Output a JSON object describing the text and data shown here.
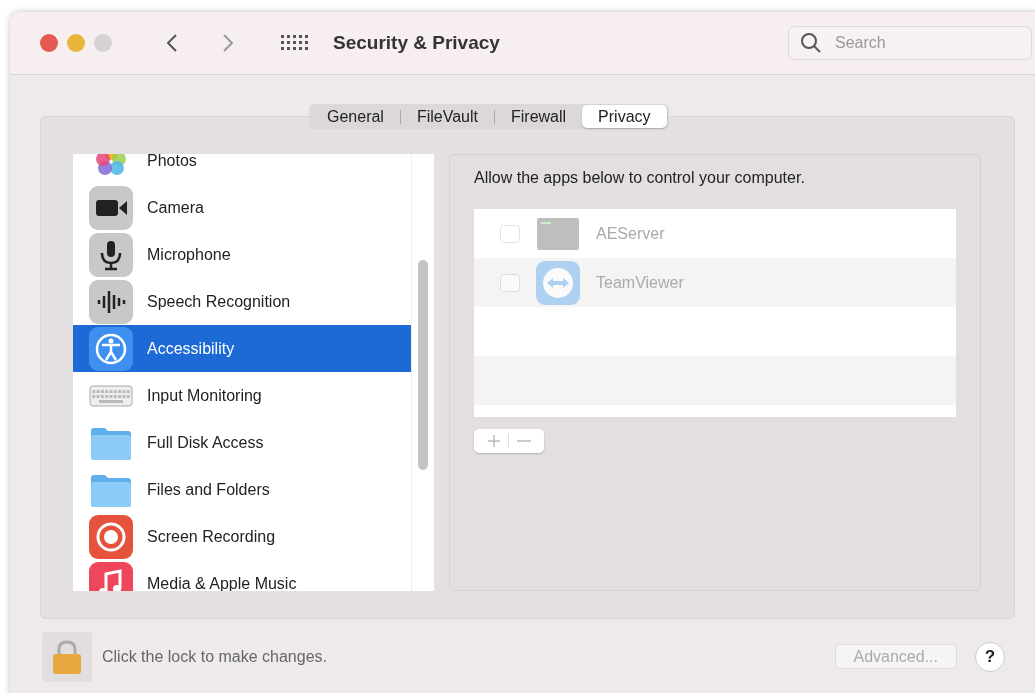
{
  "window": {
    "title": "Security & Privacy"
  },
  "search": {
    "placeholder": "Search"
  },
  "tabs": [
    {
      "label": "General",
      "selected": false
    },
    {
      "label": "FileVault",
      "selected": false
    },
    {
      "label": "Firewall",
      "selected": false
    },
    {
      "label": "Privacy",
      "selected": true
    }
  ],
  "sidebar": {
    "items": [
      {
        "label": "Photos",
        "kind": "photos",
        "selected": false
      },
      {
        "label": "Camera",
        "kind": "camera",
        "selected": false
      },
      {
        "label": "Microphone",
        "kind": "microphone",
        "selected": false
      },
      {
        "label": "Speech Recognition",
        "kind": "speech",
        "selected": false
      },
      {
        "label": "Accessibility",
        "kind": "accessibility",
        "selected": true
      },
      {
        "label": "Input Monitoring",
        "kind": "keyboard",
        "selected": false
      },
      {
        "label": "Full Disk Access",
        "kind": "folder",
        "selected": false
      },
      {
        "label": "Files and Folders",
        "kind": "folder",
        "selected": false
      },
      {
        "label": "Screen Recording",
        "kind": "record",
        "selected": false
      },
      {
        "label": "Media & Apple Music",
        "kind": "music",
        "selected": false
      }
    ]
  },
  "detail": {
    "heading": "Allow the apps below to control your computer.",
    "apps": [
      {
        "name": "AEServer",
        "kind": "terminal",
        "checked": false,
        "disabled": true
      },
      {
        "name": "TeamViewer",
        "kind": "teamviewer",
        "checked": false,
        "disabled": true
      }
    ],
    "add_remove_disabled": true
  },
  "footer": {
    "lock_text": "Click the lock to make changes.",
    "advanced_button": "Advanced...",
    "advanced_disabled": true,
    "help_button": "?"
  }
}
